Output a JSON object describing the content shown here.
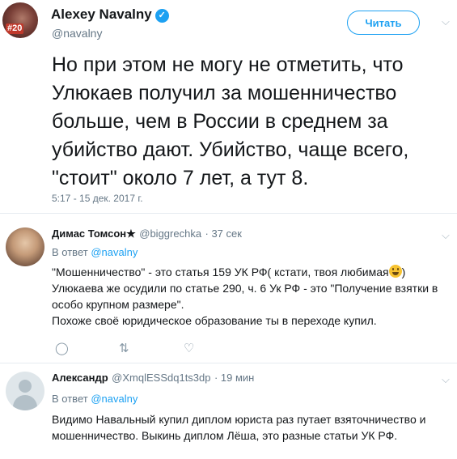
{
  "main_tweet": {
    "author_name": "Alexey Navalny",
    "verified_mark": "✓",
    "avatar_badge": "#20",
    "handle": "@navalny",
    "follow_label": "Читать",
    "text": "Но при этом не могу не отметить, что Улюкаев получил за мошенничество больше, чем в России в среднем за убийство дают. Убийство, чаще всего, \"стоит\" около 7 лет, а тут 8.",
    "timestamp": "5:17 - 15 дек. 2017 г."
  },
  "replies": [
    {
      "author_name": "Димас Томсон★",
      "handle": "@biggrechka",
      "age": "· 37 сек",
      "reply_to_prefix": "В ответ",
      "reply_to_handle": "@navalny",
      "text_1": "\"Мошенничество\" - это статья 159 УК РФ( кстати, твоя любимая",
      "text_1_end": ")",
      "text_2": "Улюкаева же осудили по статье 290, ч. 6 Ук РФ - это \"Получение взятки в особо крупном размере\".",
      "text_3": "Похоже своё юридическое образование ты в переходе купил."
    },
    {
      "author_name": "Александр",
      "handle": "@XmqlESSdq1ts3dp",
      "age": "· 19 мин",
      "reply_to_prefix": "В ответ",
      "reply_to_handle": "@navalny",
      "text": "Видимо Навальный купил диплом юриста раз путает взяточничество и мошенничество. Выкинь диплом Лёша, это разные статьи УК РФ."
    }
  ],
  "icons": {
    "chevron": "⌵",
    "reply": "◯",
    "retweet": "⇅",
    "like": "♡"
  },
  "colors": {
    "accent": "#1da1f2",
    "secondary_text": "#657786",
    "divider": "#e6ecf0",
    "emoji": "#f7c331"
  }
}
